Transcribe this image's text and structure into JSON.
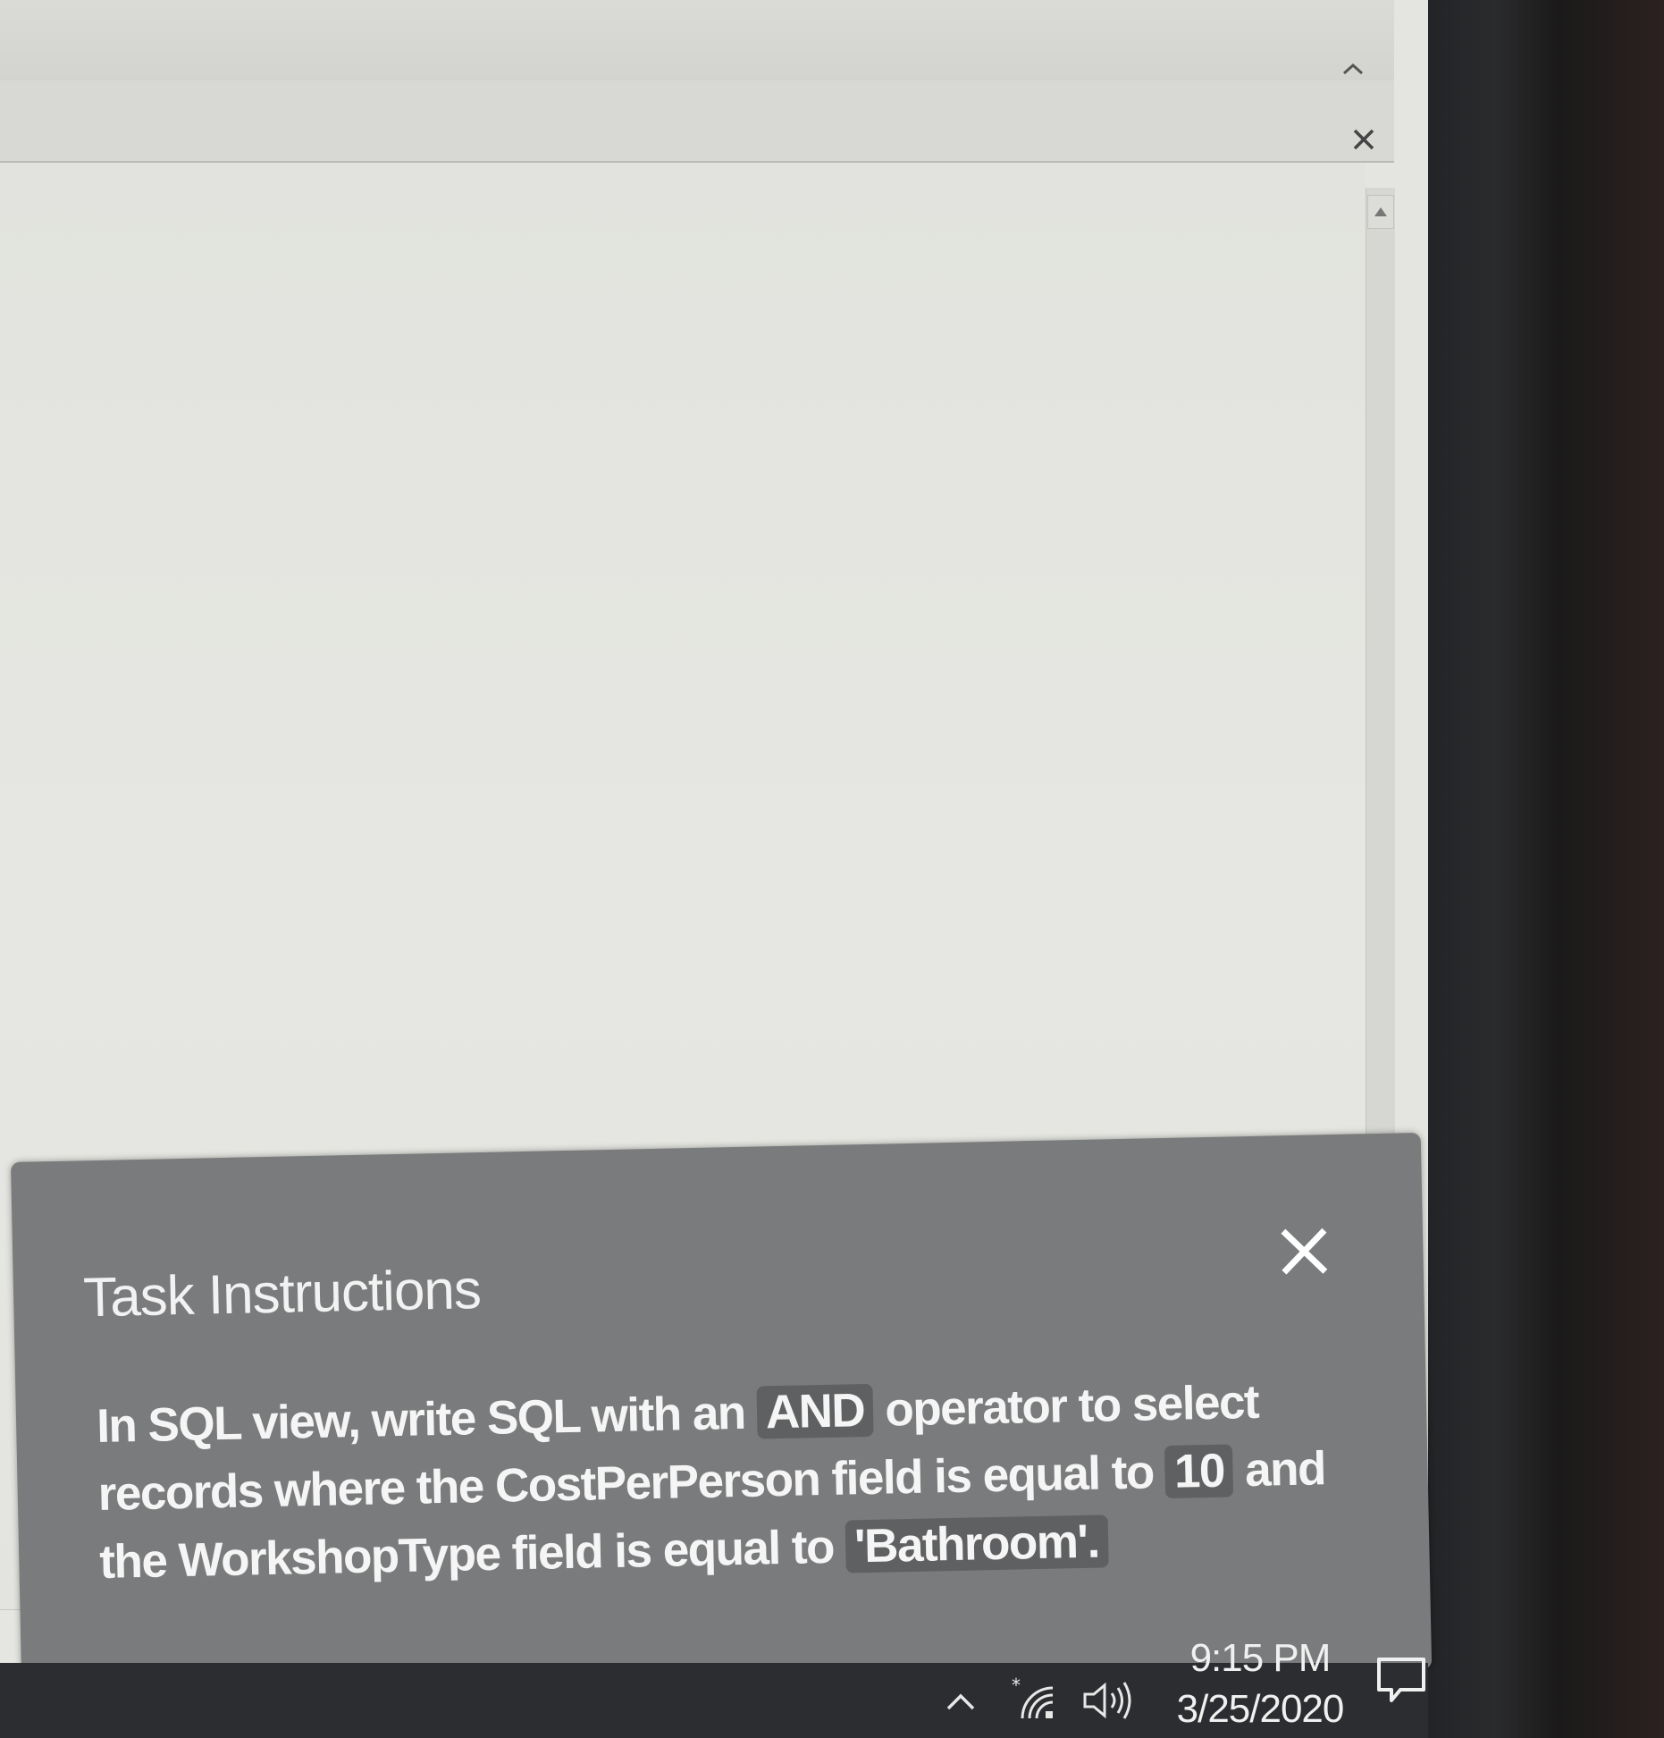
{
  "window": {
    "collapse_ribbon_icon": "chevron-up-icon",
    "close_message_bar_icon": "close-icon",
    "scroll_up_icon": "triangle-up-icon"
  },
  "task_panel": {
    "title": "Task Instructions",
    "close_icon": "close-icon",
    "instruction_segments": {
      "s1": "In SQL view, write SQL with an ",
      "c1": "AND",
      "s2": " operator to select records where the CostPerPerson field is equal to ",
      "c2": "10",
      "s3": " and the WorkshopType field is equal to ",
      "c3": "'Bathroom'."
    }
  },
  "taskbar": {
    "tray_icons": [
      "chevron-up-icon",
      "wifi-icon",
      "volume-icon"
    ],
    "time": "9:15 PM",
    "date": "3/25/2020",
    "notification_icon": "notification-icon"
  },
  "colors": {
    "panel_bg": "#7a7b7c",
    "code_bg": "#5f6061",
    "taskbar_bg": "#2c2d30",
    "screen_bg": "#e4e5e0"
  }
}
